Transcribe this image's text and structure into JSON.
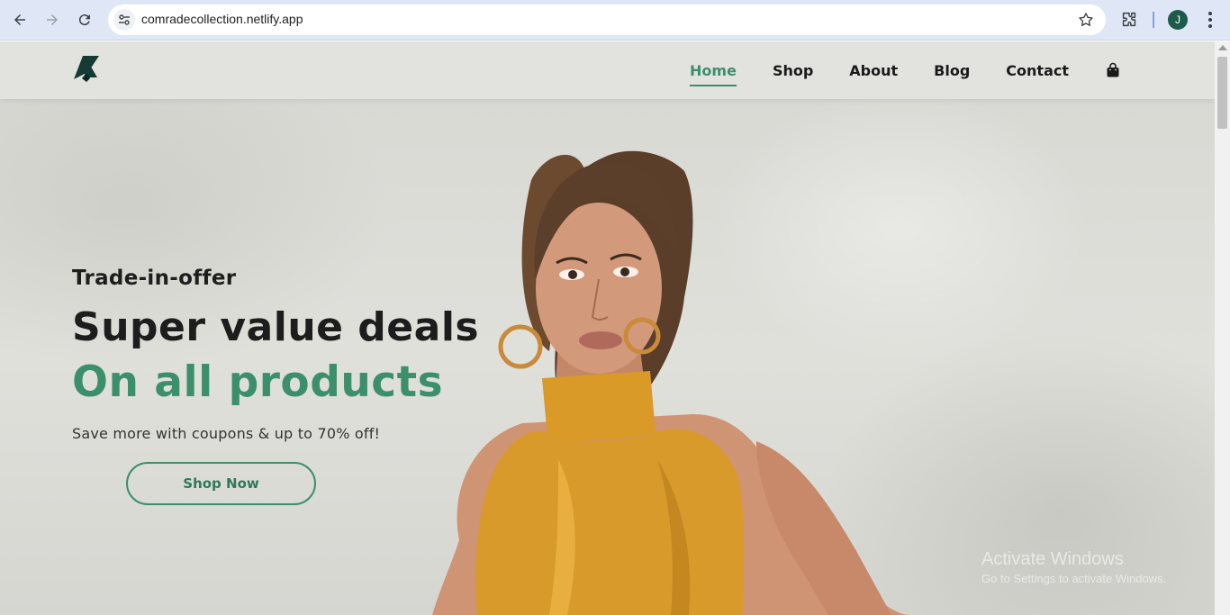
{
  "browser": {
    "url": "comradecollection.netlify.app",
    "profile_initial": "J",
    "icons": [
      "back-arrow-icon",
      "forward-arrow-icon",
      "reload-icon",
      "site-settings-icon",
      "bookmark-star-icon",
      "extensions-puzzle-icon",
      "kebab-menu-icon"
    ]
  },
  "header": {
    "logo": "comrade-logo-icon",
    "nav": [
      {
        "label": "Home",
        "active": true
      },
      {
        "label": "Shop",
        "active": false
      },
      {
        "label": "About",
        "active": false
      },
      {
        "label": "Blog",
        "active": false
      },
      {
        "label": "Contact",
        "active": false
      }
    ],
    "cart_icon": "shopping-bag-icon"
  },
  "hero": {
    "subtitle": "Trade-in-offer",
    "headline": "Super value deals",
    "headline_accent": "On all products",
    "tagline": "Save more with coupons & up to 70% off!",
    "cta_label": "Shop Now",
    "image": "model-in-mustard-halter-dress"
  },
  "watermark": {
    "line1": "Activate Windows",
    "line2": "Go to Settings to activate Windows."
  },
  "colors": {
    "accent": "#3c8f6b",
    "header_bg": "#e2e3df",
    "text_dark": "#1d1d1d",
    "dress": "#d89a2a"
  }
}
